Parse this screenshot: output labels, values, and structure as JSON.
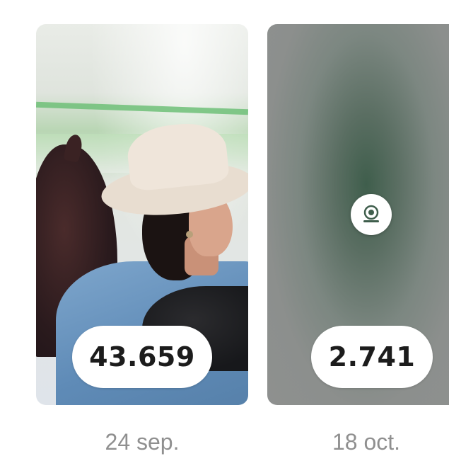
{
  "reels": [
    {
      "views": "43.659",
      "date": "24 sep.",
      "thumbnail": "cowgirl-with-horse"
    },
    {
      "views": "2.741",
      "date": "18 oct.",
      "thumbnail": "blurred-green-logo"
    }
  ],
  "colors": {
    "background": "#ffffff",
    "pill_background": "#ffffff",
    "count_text": "#1c1c1c",
    "date_text": "#8f8f8f"
  },
  "icons": {
    "logo": "brand-logo-icon"
  }
}
